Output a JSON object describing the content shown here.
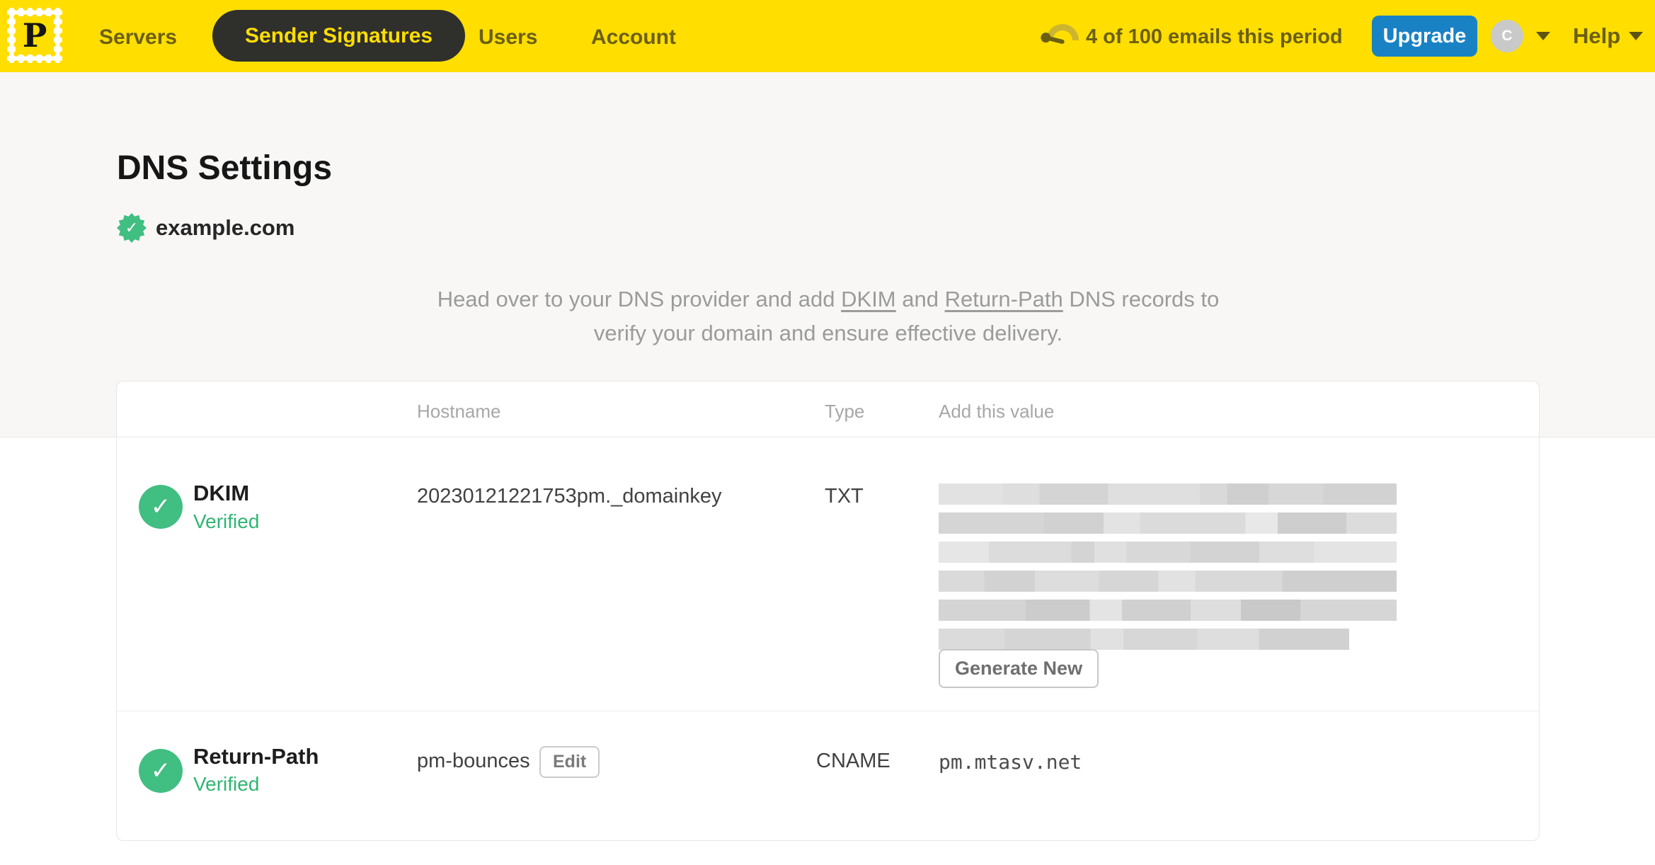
{
  "nav": {
    "logo_letter": "P",
    "items": [
      {
        "label": "Servers",
        "active": false
      },
      {
        "label": "Sender Signatures",
        "active": true
      },
      {
        "label": "Users",
        "active": false
      },
      {
        "label": "Account",
        "active": false
      }
    ],
    "usage": "4 of 100 emails this period",
    "upgrade_label": "Upgrade",
    "avatar_initial": "C",
    "help_label": "Help"
  },
  "page": {
    "title": "DNS Settings",
    "domain": "example.com",
    "domain_verified": true,
    "description": {
      "p1": "Head over to your DNS provider and add ",
      "link_dkim": "DKIM",
      "p2": " and ",
      "link_return_path": "Return-Path",
      "p3": " DNS records to",
      "line2": "verify your domain and ensure effective delivery."
    }
  },
  "table": {
    "headers": {
      "hostname": "Hostname",
      "type": "Type",
      "value": "Add this value"
    },
    "rows": [
      {
        "name": "DKIM",
        "status": "Verified",
        "hostname": "20230121221753pm._domainkey",
        "type": "TXT",
        "value_redacted": true,
        "action": "Generate New"
      },
      {
        "name": "Return-Path",
        "status": "Verified",
        "hostname": "pm-bounces",
        "edit_label": "Edit",
        "type": "CNAME",
        "value": "pm.mtasv.net"
      }
    ]
  },
  "colors": {
    "yellow": "#FFDE00",
    "navText": "#6B5F11",
    "pillBg": "#2F2F2C",
    "blue": "#1982C5",
    "green": "#41BE81",
    "greenText": "#2FB573",
    "pageBg": "#F8F7F5",
    "border": "#E7E7E6",
    "headerGray": "#A7A7A7",
    "bodyText": "#414141",
    "paraGray": "#9B9B9B"
  }
}
